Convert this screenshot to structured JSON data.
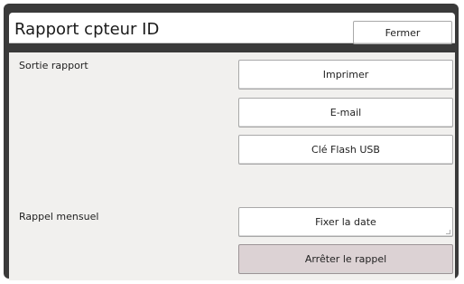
{
  "dialog": {
    "title": "Rapport cpteur ID",
    "close_label": "Fermer"
  },
  "report_output": {
    "label": "Sortie rapport",
    "buttons": [
      "Imprimer",
      "E-mail",
      "Clé Flash USB"
    ]
  },
  "monthly_reminder": {
    "label": "Rappel mensuel",
    "set_date_label": "Fixer la date",
    "stop_reminder_label": "Arrêter le rappel"
  }
}
